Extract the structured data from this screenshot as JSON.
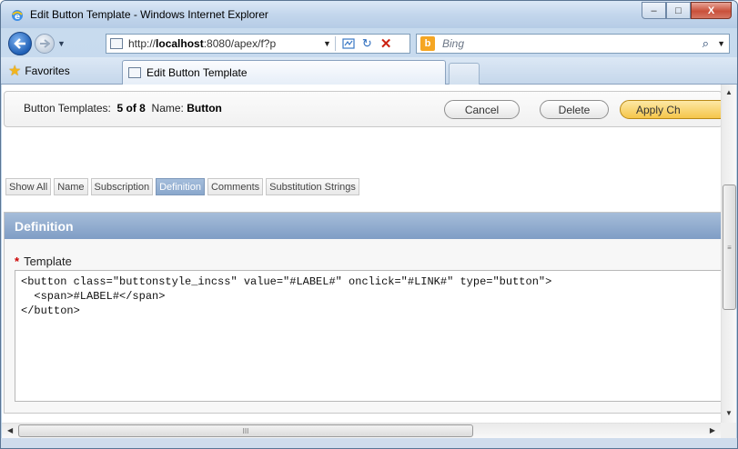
{
  "window": {
    "title": "Edit Button Template - Windows Internet Explorer",
    "minimize": "–",
    "maximize": "□",
    "close": "X"
  },
  "address_bar": {
    "url_prefix": "http://",
    "url_host": "localhost",
    "url_rest": ":8080/apex/f?p",
    "dropdown": "▼",
    "compat_icon": "compat-view-icon",
    "refresh_icon": "↻",
    "stop_icon": "✕"
  },
  "search": {
    "engine": "Bing",
    "go_icon": "⌕",
    "dropdown": "▼"
  },
  "favorites": {
    "label": "Favorites"
  },
  "tab": {
    "label": "Edit Button Template"
  },
  "header": {
    "prefix": "Button Templates:",
    "position": "5 of 8",
    "name_label": "Name:",
    "name_value": "Button",
    "cancel": "Cancel",
    "delete": "Delete",
    "apply": "Apply Ch"
  },
  "subtabs": [
    {
      "label": "Show All",
      "active": false
    },
    {
      "label": "Name",
      "active": false
    },
    {
      "label": "Subscription",
      "active": false
    },
    {
      "label": "Definition",
      "active": true
    },
    {
      "label": "Comments",
      "active": false
    },
    {
      "label": "Substitution Strings",
      "active": false
    }
  ],
  "definition": {
    "heading": "Definition",
    "required_marker": "*",
    "field_label": "Template",
    "template_text": "<button class=\"buttonstyle_incss\" value=\"#LABEL#\" onclick=\"#LINK#\" type=\"button\">\n  <span>#LABEL#</span>\n</button>"
  },
  "scrollbars": {
    "up": "▲",
    "down": "▼",
    "left": "◀",
    "right": "▶",
    "grip_v": "≡",
    "grip_h": "III"
  },
  "colors": {
    "accent_blue": "#7f9dc5",
    "apply_yellow": "#f5c54a",
    "required_red": "#cc0000"
  }
}
